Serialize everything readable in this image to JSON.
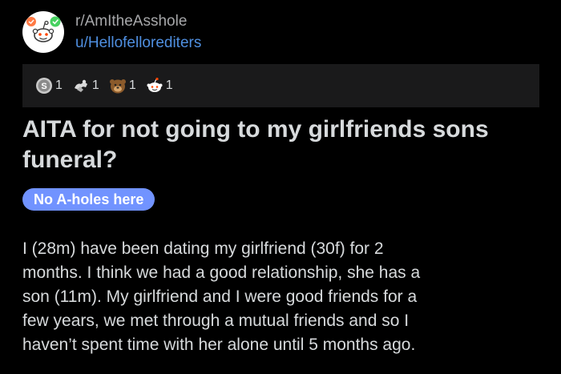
{
  "header": {
    "subreddit": "r/AmItheAsshole",
    "username": "u/Hellofellorediters",
    "avatar_icon": "snoo-avatar-icon"
  },
  "awards": [
    {
      "icon": "silver-award-icon",
      "count": "1"
    },
    {
      "icon": "helpful-award-icon",
      "count": "1"
    },
    {
      "icon": "wholesome-award-icon",
      "count": "1"
    },
    {
      "icon": "snoo-award-icon",
      "count": "1"
    }
  ],
  "post": {
    "title": "AITA for not going to my girlfriends sons funeral?",
    "flair": "No A-holes here",
    "flair_color": "#7193ff",
    "body": "I (28m) have been dating my girlfriend  (30f) for 2\nmonths. I think we had a good relationship, she has a\nson (11m). My girlfriend and I were good friends for a\nfew years, we met through a mutual friends and so I\nhaven’t spent time with her alone until 5 months ago."
  },
  "colors": {
    "background": "#000000",
    "text": "#d7dadc",
    "link": "#4f8fe0",
    "muted": "#a6a7a9",
    "awards_bar": "#1a1a1b"
  }
}
